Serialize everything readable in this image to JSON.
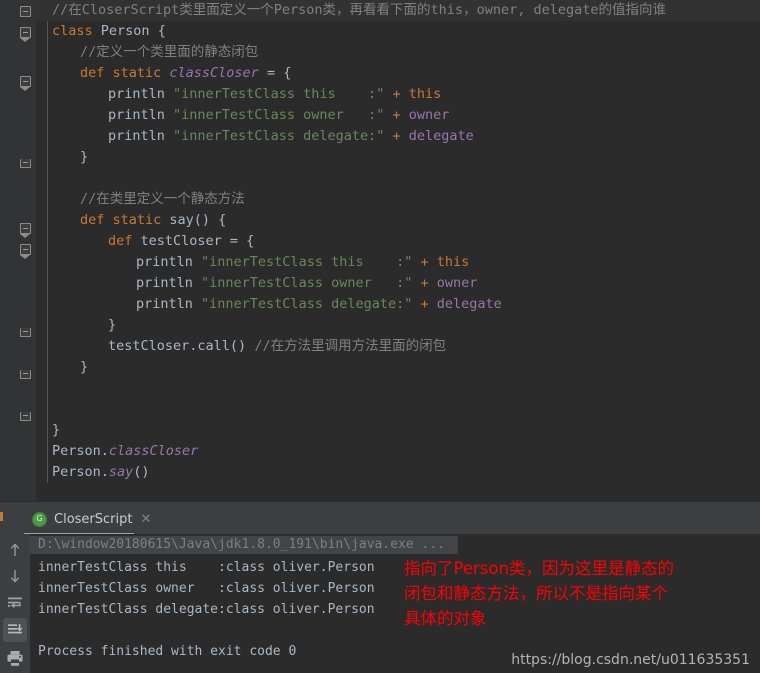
{
  "editor": {
    "language": "Groovy",
    "lines": [
      {
        "indent": 0,
        "tokens": [
          {
            "t": "//在CloserScript类里面定义一个Person类，再看看下面的this，owner, delegate的值指向谁",
            "c": "c-comment"
          }
        ]
      },
      {
        "indent": 0,
        "tokens": [
          {
            "t": "class ",
            "c": "c-keyword"
          },
          {
            "t": "Person ",
            "c": "c-plain"
          },
          {
            "t": "{",
            "c": "c-plain"
          }
        ]
      },
      {
        "indent": 1,
        "tokens": [
          {
            "t": "//定义一个类里面的静态闭包",
            "c": "c-comment"
          }
        ]
      },
      {
        "indent": 1,
        "tokens": [
          {
            "t": "def static ",
            "c": "c-keyword"
          },
          {
            "t": "classCloser",
            "c": "c-purple"
          },
          {
            "t": " = {",
            "c": "c-plain"
          }
        ]
      },
      {
        "indent": 2,
        "tokens": [
          {
            "t": "println ",
            "c": "c-plain"
          },
          {
            "t": "\"innerTestClass this    :\"",
            "c": "c-string"
          },
          {
            "t": " + ",
            "c": "c-orange"
          },
          {
            "t": "this",
            "c": "c-orange"
          }
        ]
      },
      {
        "indent": 2,
        "tokens": [
          {
            "t": "println ",
            "c": "c-plain"
          },
          {
            "t": "\"innerTestClass owner   :\"",
            "c": "c-string"
          },
          {
            "t": " + ",
            "c": "c-orange"
          },
          {
            "t": "owner",
            "c": "c-purple-n"
          }
        ]
      },
      {
        "indent": 2,
        "tokens": [
          {
            "t": "println ",
            "c": "c-plain"
          },
          {
            "t": "\"innerTestClass delegate:\"",
            "c": "c-string"
          },
          {
            "t": " + ",
            "c": "c-orange"
          },
          {
            "t": "delegate",
            "c": "c-purple-n"
          }
        ]
      },
      {
        "indent": 1,
        "tokens": [
          {
            "t": "}",
            "c": "c-plain"
          }
        ]
      },
      {
        "indent": 0,
        "tokens": []
      },
      {
        "indent": 1,
        "tokens": [
          {
            "t": "//在类里定义一个静态方法",
            "c": "c-comment"
          }
        ]
      },
      {
        "indent": 1,
        "tokens": [
          {
            "t": "def static ",
            "c": "c-keyword"
          },
          {
            "t": "say() {",
            "c": "c-plain"
          }
        ]
      },
      {
        "indent": 2,
        "tokens": [
          {
            "t": "def ",
            "c": "c-keyword"
          },
          {
            "t": "testCloser = {",
            "c": "c-plain"
          }
        ]
      },
      {
        "indent": 3,
        "tokens": [
          {
            "t": "println ",
            "c": "c-plain"
          },
          {
            "t": "\"innerTestClass this    :\"",
            "c": "c-string"
          },
          {
            "t": " + ",
            "c": "c-orange"
          },
          {
            "t": "this",
            "c": "c-orange"
          }
        ]
      },
      {
        "indent": 3,
        "tokens": [
          {
            "t": "println ",
            "c": "c-plain"
          },
          {
            "t": "\"innerTestClass owner   :\"",
            "c": "c-string"
          },
          {
            "t": " + ",
            "c": "c-orange"
          },
          {
            "t": "owner",
            "c": "c-purple-n"
          }
        ]
      },
      {
        "indent": 3,
        "tokens": [
          {
            "t": "println ",
            "c": "c-plain"
          },
          {
            "t": "\"innerTestClass delegate:\"",
            "c": "c-string"
          },
          {
            "t": " + ",
            "c": "c-orange"
          },
          {
            "t": "delegate",
            "c": "c-purple-n"
          }
        ]
      },
      {
        "indent": 2,
        "tokens": [
          {
            "t": "}",
            "c": "c-plain"
          }
        ]
      },
      {
        "indent": 2,
        "tokens": [
          {
            "t": "testCloser.call() ",
            "c": "c-plain"
          },
          {
            "t": "//在方法里调用方法里面的闭包",
            "c": "c-comment"
          }
        ]
      },
      {
        "indent": 1,
        "tokens": [
          {
            "t": "}",
            "c": "c-plain"
          }
        ]
      },
      {
        "indent": 0,
        "tokens": []
      },
      {
        "indent": 0,
        "tokens": []
      },
      {
        "indent": 0,
        "tokens": [
          {
            "t": "}",
            "c": "c-plain"
          }
        ]
      },
      {
        "indent": 0,
        "tokens": [
          {
            "t": "Person.",
            "c": "c-plain"
          },
          {
            "t": "classCloser",
            "c": "c-purple"
          }
        ]
      },
      {
        "indent": 0,
        "tokens": [
          {
            "t": "Person.",
            "c": "c-plain"
          },
          {
            "t": "say",
            "c": "c-purple"
          },
          {
            "t": "()",
            "c": "c-plain"
          }
        ]
      }
    ]
  },
  "console": {
    "tab_label": "CloserScript",
    "tab_close_glyph": "✕",
    "run_icon_letter": "G",
    "toolbar": [
      {
        "name": "scroll-up-button",
        "title": "Up"
      },
      {
        "name": "scroll-down-button",
        "title": "Down"
      },
      {
        "name": "soft-wrap-button",
        "title": "Soft-Wrap"
      },
      {
        "name": "scroll-to-end-button",
        "title": "Scroll to End"
      },
      {
        "name": "print-button",
        "title": "Print"
      }
    ],
    "command_line": "D:\\window20180615\\Java\\jdk1.8.0_191\\bin\\java.exe ...",
    "output_lines": [
      "innerTestClass this    :class oliver.Person",
      "innerTestClass owner   :class oliver.Person",
      "innerTestClass delegate:class oliver.Person",
      "",
      "Process finished with exit code 0"
    ]
  },
  "annotation": {
    "text": "指向了Person类，因为这里是静态的\n闭包和静态方法，所以不是指向某个\n具体的对象",
    "color": "#ff0000"
  },
  "watermark": {
    "text": "https://blog.csdn.net/u011635351"
  }
}
